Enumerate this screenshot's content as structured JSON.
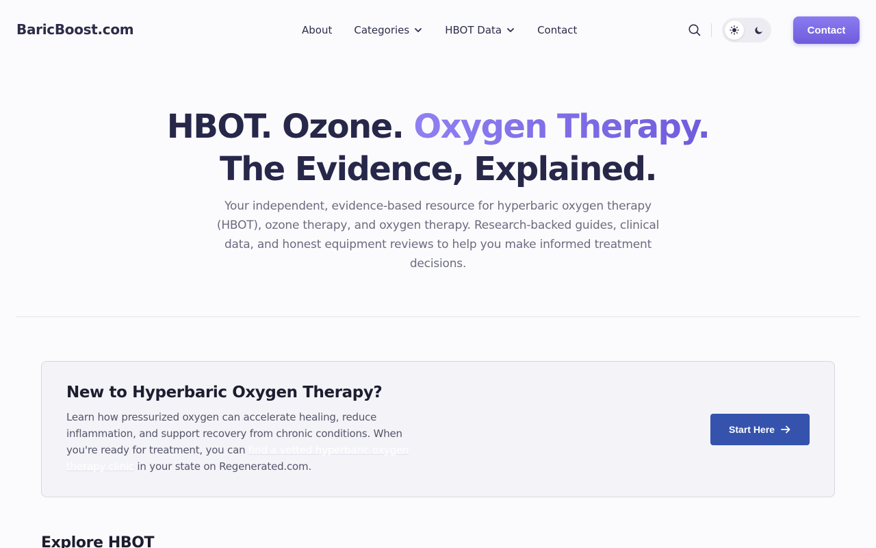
{
  "header": {
    "brand": "BaricBoost.com",
    "nav": [
      {
        "label": "About",
        "has_dropdown": false
      },
      {
        "label": "Categories",
        "has_dropdown": true
      },
      {
        "label": "HBOT Data",
        "has_dropdown": true
      },
      {
        "label": "Contact",
        "has_dropdown": false
      }
    ],
    "search_icon": "search-icon",
    "theme_toggle": {
      "options": [
        "sun-icon",
        "moon-icon"
      ],
      "active": "light"
    },
    "cta_label": "Contact"
  },
  "hero": {
    "title_part1": "HBOT. Ozone. ",
    "title_accent": "Oxygen Therapy.",
    "title_part2": " The Evidence, Explained.",
    "subtitle": "Your independent, evidence-based resource for hyperbaric oxygen therapy (HBOT), ozone therapy, and oxygen therapy. Research-backed guides, clinical data, and honest equipment reviews to help you make informed treatment decisions."
  },
  "callout": {
    "title": "New to Hyperbaric Oxygen Therapy?",
    "body_before": "Learn how pressurized oxygen can accelerate healing, reduce inflammation, and support recovery from chronic conditions. When you're ready for treatment, you can ",
    "link_text": "find a vetted hyperbaric oxygen therapy clinic",
    "body_after": " in your state on Regenerated.com.",
    "button_label": "Start Here",
    "button_icon": "arrow-right-icon"
  },
  "next_section": {
    "title": "Explore HBOT"
  },
  "colors": {
    "accent_gradient_start": "#8f80f2",
    "accent_gradient_end": "#6f5bdc",
    "primary_button": "#3553ad",
    "text_dark": "#27274a",
    "text_muted": "#6b6b80"
  }
}
